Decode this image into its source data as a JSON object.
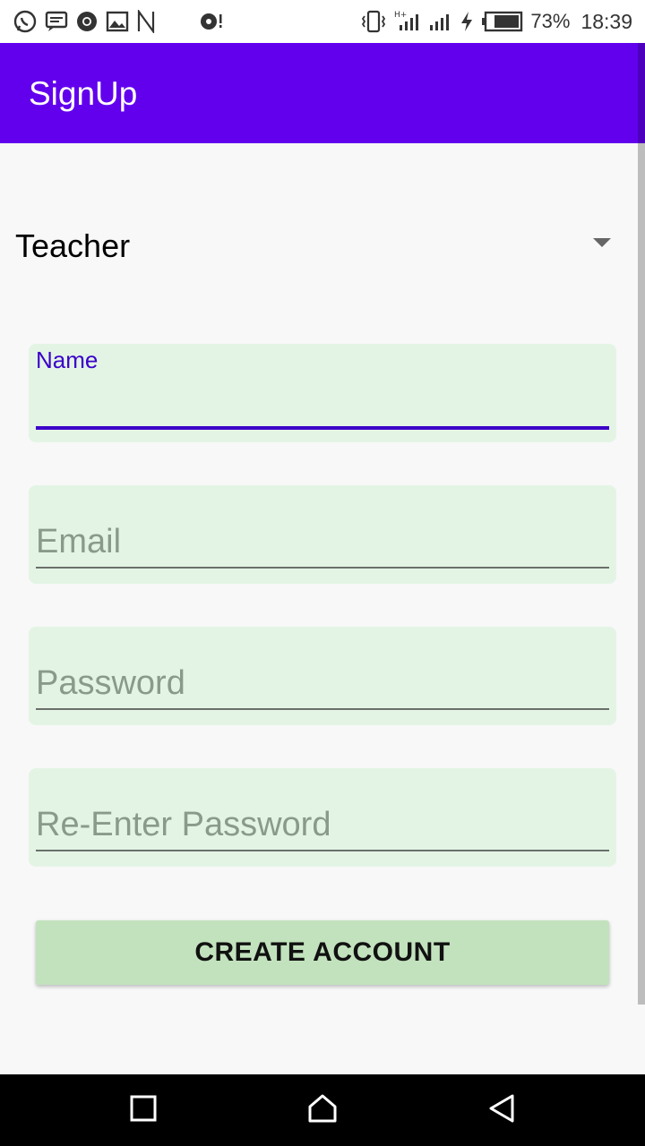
{
  "status_bar": {
    "battery_percent": "73%",
    "time": "18:39",
    "left_icons": [
      "whatsapp-icon",
      "message-icon",
      "chrome-icon",
      "gallery-icon",
      "n-icon",
      "notification-icon"
    ],
    "right_icons": [
      "vibrate-icon",
      "signal-icon",
      "signal-icon",
      "charging-icon",
      "battery-icon"
    ]
  },
  "app_bar": {
    "title": "SignUp"
  },
  "form": {
    "role_spinner": {
      "selected": "Teacher"
    },
    "name": {
      "label": "Name",
      "value": ""
    },
    "email": {
      "placeholder": "Email",
      "value": ""
    },
    "password": {
      "placeholder": "Password",
      "value": ""
    },
    "reenter_password": {
      "placeholder": "Re-Enter Password",
      "value": ""
    },
    "create_button_label": "CREATE ACCOUNT"
  },
  "nav_bar": {
    "buttons": [
      "recents-icon",
      "home-icon",
      "back-icon"
    ]
  },
  "colors": {
    "app_bar": "#6200ee",
    "field_bg": "#e3f4e5",
    "focus": "#3b00c9",
    "button_bg": "#c2e2bd"
  }
}
